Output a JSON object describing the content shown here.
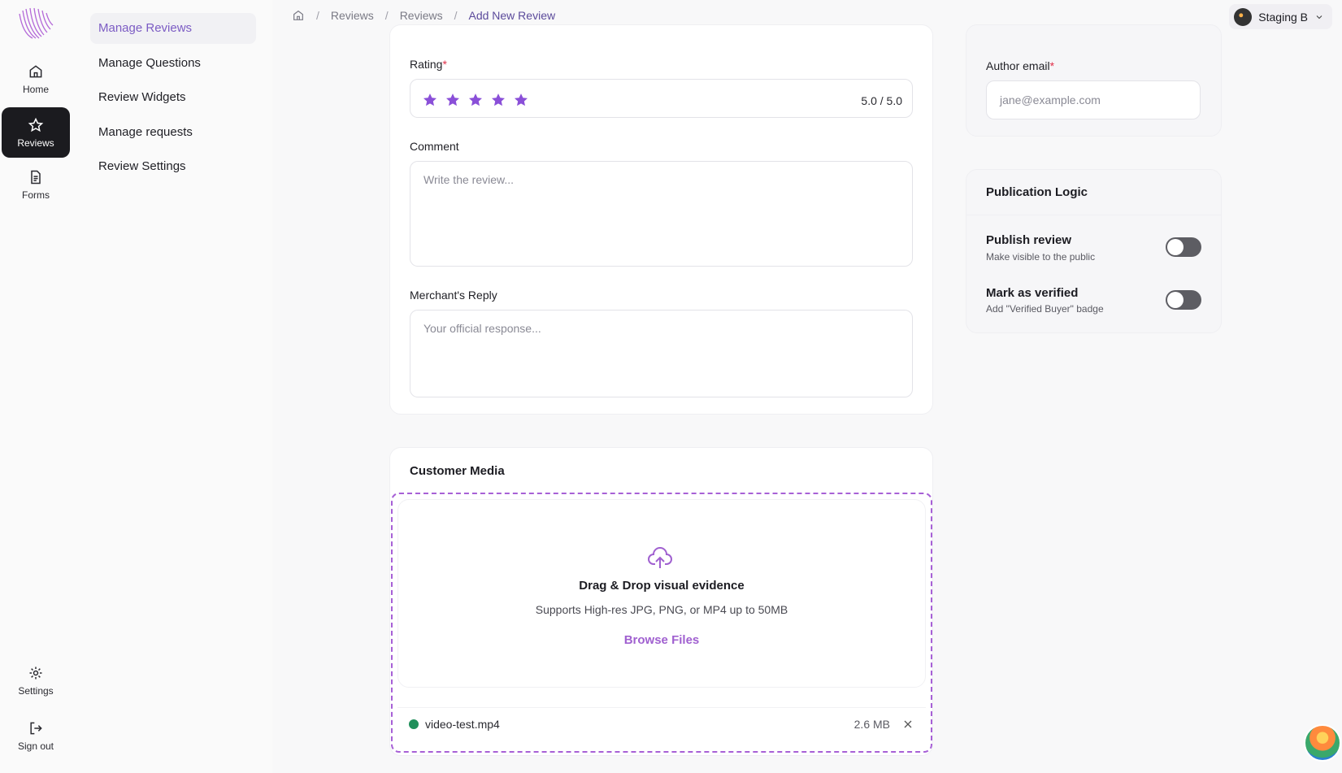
{
  "rail": {
    "items": [
      {
        "label": "Home",
        "icon": "home-icon"
      },
      {
        "label": "Reviews",
        "icon": "star-icon",
        "active": true
      },
      {
        "label": "Forms",
        "icon": "document-icon"
      },
      {
        "label": "Settings",
        "icon": "gear-icon"
      },
      {
        "label": "Sign out",
        "icon": "sign-out-icon"
      }
    ]
  },
  "subnav": {
    "items": [
      "Manage Reviews",
      "Manage Questions",
      "Review Widgets",
      "Manage requests",
      "Review Settings"
    ]
  },
  "breadcrumb": [
    "Reviews",
    "Reviews",
    "Add New Review"
  ],
  "org": {
    "name": "Staging B"
  },
  "form": {
    "rating_label": "Rating",
    "rating_value": "5.0 / 5.0",
    "rating_stars": 5,
    "comment_label": "Comment",
    "comment_placeholder": "Write the review...",
    "reply_label": "Merchant's Reply",
    "reply_placeholder": "Your official response..."
  },
  "media": {
    "title": "Customer Media",
    "drop_title": "Drag & Drop visual evidence",
    "drop_sub": "Supports High-res JPG, PNG, or MP4 up to 50MB",
    "browse": "Browse Files",
    "file": {
      "name": "video-test.mp4",
      "size": "2.6 MB"
    }
  },
  "author": {
    "email_label": "Author email",
    "email_placeholder": "jane@example.com"
  },
  "publication": {
    "title": "Publication Logic",
    "publish": {
      "title": "Publish review",
      "sub": "Make visible to the public"
    },
    "verified": {
      "title": "Mark as verified",
      "sub": "Add \"Verified Buyer\" badge"
    }
  },
  "colors": {
    "accent": "#7c5cc4",
    "star": "#8a4fd8",
    "dashed": "#a760d6"
  },
  "required_mark": "*"
}
